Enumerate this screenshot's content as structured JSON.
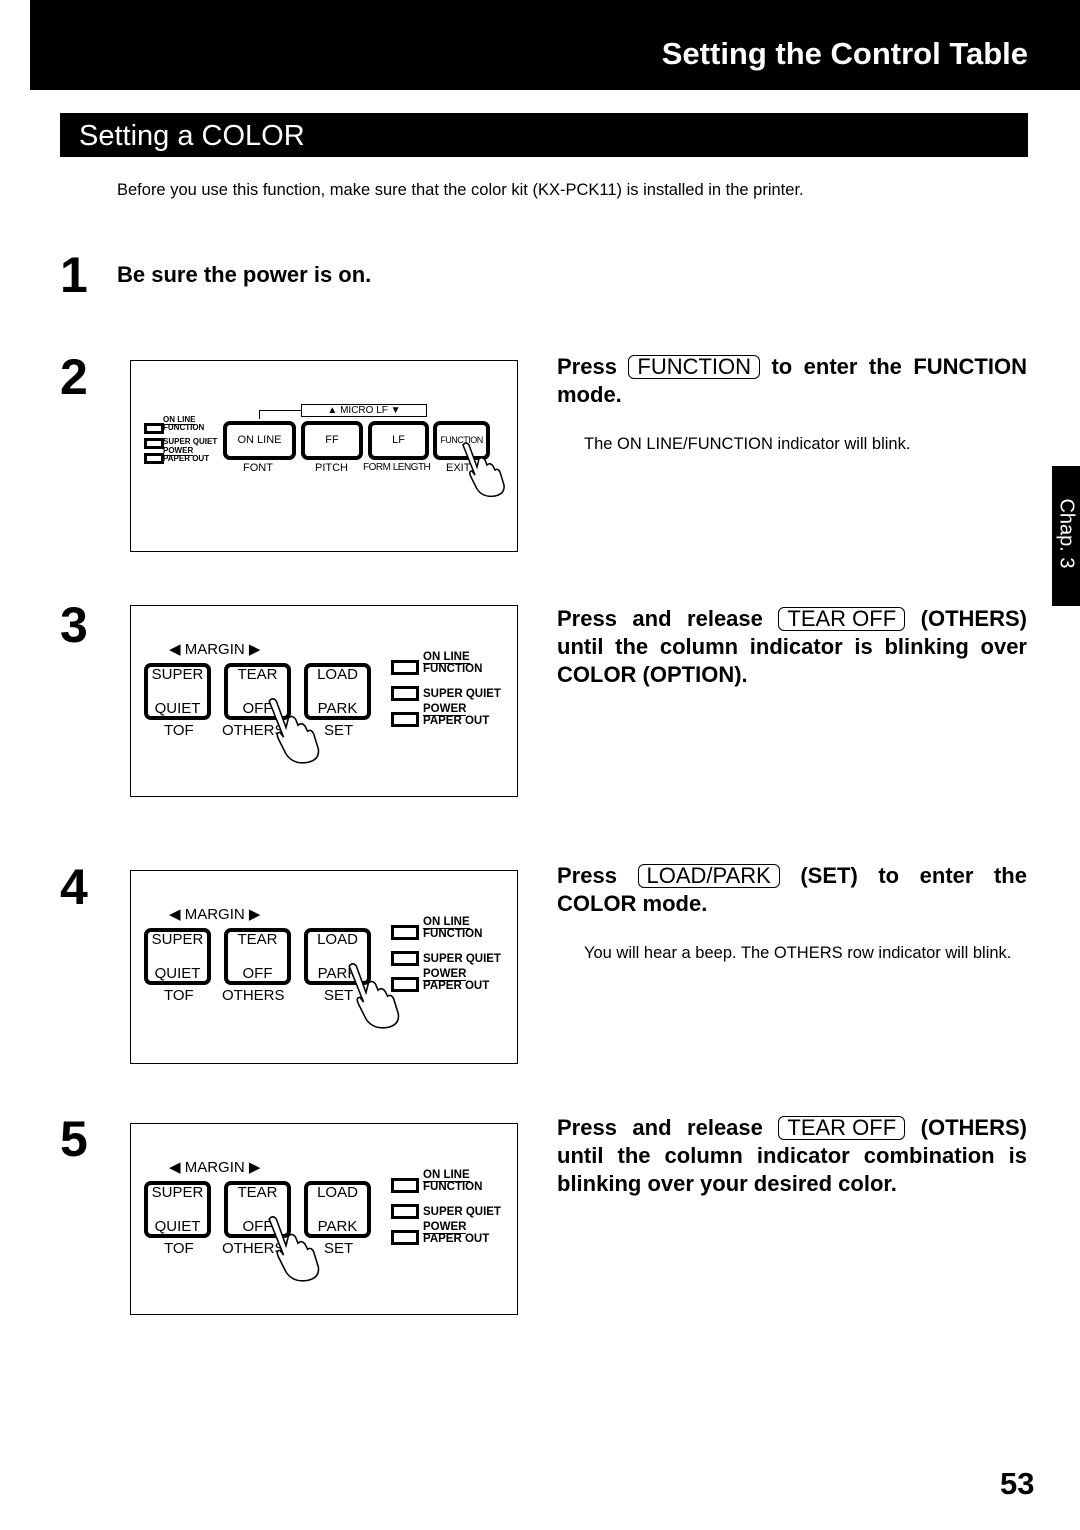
{
  "header": {
    "title": "Setting the Control Table"
  },
  "section": {
    "title": "Setting a COLOR"
  },
  "intro": "Before you use this function, make sure that the color kit (KX-PCK11) is installed in the printer.",
  "side_tab": "Chap. 3",
  "page_number": "53",
  "steps": [
    {
      "number": "1",
      "heading": "Be sure the power is on."
    },
    {
      "number": "2",
      "heading_pre": "Press",
      "key": "FUNCTION",
      "heading_post": "to enter the FUNCTION mode.",
      "note": "The ON LINE/FUNCTION indicator will blink."
    },
    {
      "number": "3",
      "heading_pre": "Press and release",
      "key": "TEAR OFF",
      "heading_post": "(OTHERS) until the column indicator is blinking over COLOR (OPTION)."
    },
    {
      "number": "4",
      "heading_pre": "Press",
      "key": "LOAD/PARK",
      "heading_post": "(SET) to enter the COLOR mode.",
      "note": "You will hear a beep. The OTHERS row indicator will blink."
    },
    {
      "number": "5",
      "heading_pre": "Press and release",
      "key": "TEAR OFF",
      "heading_post": "(OTHERS) until the column indicator combination is blinking over your desired color."
    }
  ],
  "panel2": {
    "indicators": [
      {
        "top": "ON LINE",
        "bottom": "FUNCTION"
      },
      {
        "top": "SUPER QUIET"
      },
      {
        "top": "POWER",
        "bottom": "PAPER OUT"
      }
    ],
    "micro_lf": "▲ MICRO LF ▼",
    "buttons": [
      {
        "label": "ON LINE",
        "sub": "FONT"
      },
      {
        "label": "FF",
        "sub": "PITCH"
      },
      {
        "label": "LF",
        "sub": "FORM LENGTH"
      },
      {
        "label": "FUNCTION",
        "sub": "EXIT"
      }
    ]
  },
  "panel_common": {
    "margin": "◀ MARGIN ▶",
    "buttons": [
      {
        "line1": "SUPER",
        "line2": "QUIET",
        "sub": "TOF"
      },
      {
        "line1": "TEAR",
        "line2": "OFF",
        "sub": "OTHERS"
      },
      {
        "line1": "LOAD",
        "line2": "PARK",
        "sub": "SET"
      }
    ],
    "indicators": [
      {
        "top": "ON LINE",
        "bottom": "FUNCTION"
      },
      {
        "top": "SUPER QUIET"
      },
      {
        "top": "POWER",
        "bottom": "PAPER OUT"
      }
    ]
  },
  "panel_hand_target": {
    "3": "TEAR OFF",
    "4": "LOAD PARK",
    "5": "TEAR OFF"
  },
  "colors": {
    "bar": "#000000",
    "text": "#000000",
    "background": "#ffffff"
  },
  "icons": {
    "hand": "pointing-hand-icon",
    "led": "indicator-lamp-icon"
  }
}
